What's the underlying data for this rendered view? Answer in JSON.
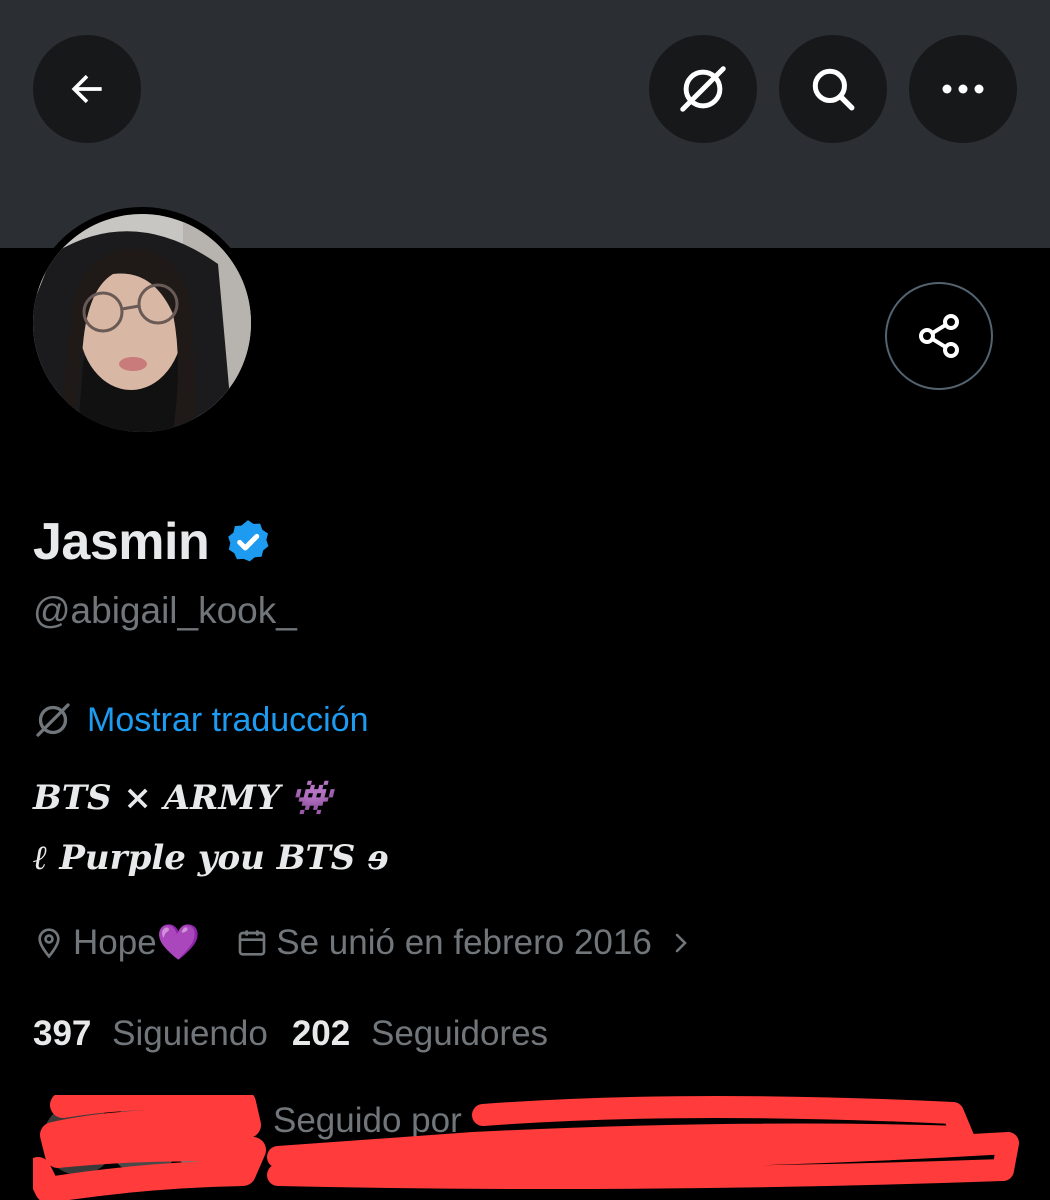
{
  "header": {
    "back_icon": "arrow-left-icon",
    "translate_icon": "translate-globe-icon",
    "search_icon": "search-icon",
    "more_icon": "more-dots-icon"
  },
  "profile": {
    "display_name": "Jasmin",
    "verified": true,
    "handle": "@abigail_kook_",
    "share_icon": "share-icon",
    "translate_label": "Mostrar traducción",
    "bio_line1": "BTS × ARMY",
    "bio_line1_emoji": "👾",
    "bio_line2": "ℓ Purple you BTS ɘ",
    "location": "Hope💜",
    "joined": "Se unió en febrero 2016",
    "following_count": "397",
    "following_label": "Siguiendo",
    "followers_count": "202",
    "followers_label": "Seguidores",
    "followed_by_prefix": "Seguido por"
  },
  "colors": {
    "accent": "#1d9bf0",
    "muted": "#71767b",
    "banner": "#2b2e32",
    "redaction": "#ff3b3b"
  }
}
